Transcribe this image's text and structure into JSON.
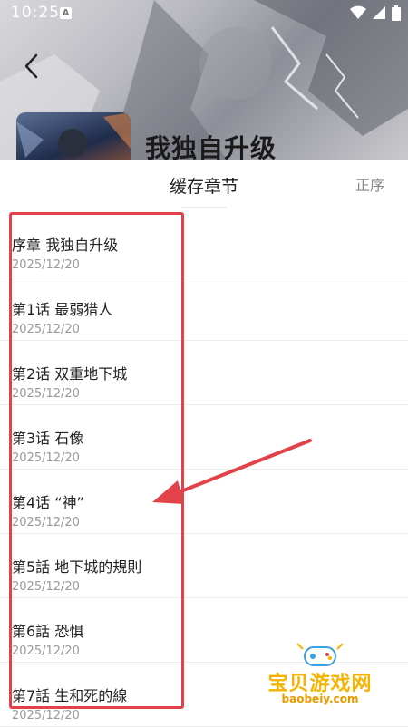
{
  "status_bar": {
    "time": "10:25",
    "notification_icon": "A"
  },
  "header": {
    "comic_title": "我独自升级"
  },
  "sheet": {
    "title": "缓存章节",
    "sort_label": "正序"
  },
  "chapters": [
    {
      "name": "序章 我独自升级",
      "date": "2025/12/20"
    },
    {
      "name": "第1话 最弱猎人",
      "date": "2025/12/20"
    },
    {
      "name": "第2话 双重地下城",
      "date": "2025/12/20"
    },
    {
      "name": "第3话 石像",
      "date": "2025/12/20"
    },
    {
      "name": "第4话 “神”",
      "date": "2025/12/20"
    },
    {
      "name": "第5話 地下城的規則",
      "date": "2025/12/20"
    },
    {
      "name": "第6話 恐惧",
      "date": "2025/12/20"
    },
    {
      "name": "第7話 生和死的線",
      "date": "2025/12/20"
    }
  ],
  "watermark": {
    "text": "宝贝游戏网",
    "url": "baobeiy.com"
  },
  "colors": {
    "highlight": "#e2434a",
    "watermark": "#f5b400"
  }
}
